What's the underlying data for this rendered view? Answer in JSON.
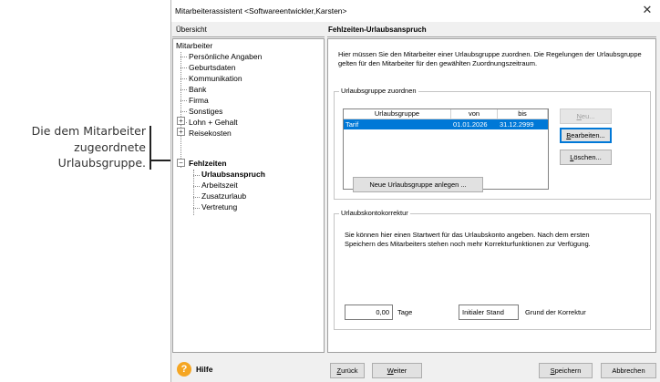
{
  "callout": {
    "line1": "Die dem Mitarbeiter",
    "line2": "zugeordnete",
    "line3": "Urlaubsgruppe."
  },
  "window": {
    "title": "Mitarbeiterassistent <Softwareentwickler,Karsten>",
    "close_glyph": "✕"
  },
  "sidebar": {
    "header": "Übersicht",
    "root": "Mitarbeiter",
    "items": [
      {
        "label": "Persönliche Angaben"
      },
      {
        "label": "Geburtsdaten"
      },
      {
        "label": "Kommunikation"
      },
      {
        "label": "Bank"
      },
      {
        "label": "Firma"
      },
      {
        "label": "Sonstiges"
      },
      {
        "label": "Lohn + Gehalt",
        "expander": "+"
      },
      {
        "label": "Reisekosten",
        "expander": "+"
      },
      {
        "label": "Fehlzeiten",
        "expander": "−"
      }
    ],
    "subitems": [
      {
        "label": "Urlaubsanspruch"
      },
      {
        "label": "Arbeitszeit"
      },
      {
        "label": "Zusatzurlaub"
      },
      {
        "label": "Vertretung"
      }
    ]
  },
  "main": {
    "header": "Fehlzeiten-Urlaubsanspruch",
    "intro": "Hier müssen Sie den Mitarbeiter einer Urlaubsgruppe zuordnen. Die Regelungen der Urlaubsgruppe gelten für den Mitarbeiter für den gewählten Zuordnungszeitraum.",
    "group1": {
      "title": "Urlaubsgruppe zuordnen",
      "columns": [
        "Urlaubsgruppe",
        "von",
        "bis"
      ],
      "rows": [
        {
          "name": "Tarif",
          "from": "01.01.2026",
          "to": "31.12.2999"
        }
      ],
      "btn_new": {
        "pre": "",
        "key": "N",
        "post": "eu..."
      },
      "btn_edit": {
        "pre": "",
        "key": "B",
        "post": "earbeiten..."
      },
      "btn_delete": {
        "pre": "",
        "key": "L",
        "post": "öschen..."
      },
      "btn_add": "Neue Urlaubsgruppe anlegen ..."
    },
    "group2": {
      "title": "Urlaubskontokorrektur",
      "text": "Sie können hier einen Startwert für das Urlaubskonto angeben. Nach dem ersten Speichern des Mitarbeiters stehen noch mehr Korrekturfunktionen zur Verfügung.",
      "days_value": "0,00",
      "days_label": "Tage",
      "reason_value": "Initialer Stand",
      "reason_label": "Grund der Korrektur"
    }
  },
  "footer": {
    "help_glyph": "?",
    "help_label": "Hilfe",
    "back": {
      "key": "Z",
      "post": "urück"
    },
    "next": {
      "key": "W",
      "post": "eiter"
    },
    "save": {
      "key": "S",
      "post": "peichern"
    },
    "cancel": "Abbrechen"
  },
  "colors": {
    "selection": "#0078d7",
    "help_icon": "#f5a623"
  }
}
